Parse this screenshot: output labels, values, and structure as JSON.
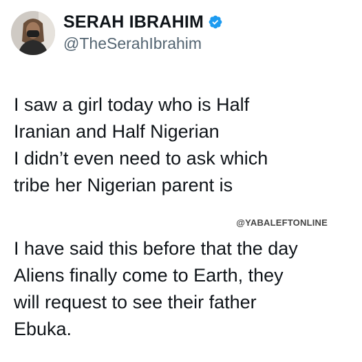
{
  "author": {
    "display_name": "SERAH IBRAHIM",
    "handle": "@TheSerahIbrahim",
    "verified": true
  },
  "tweet": {
    "paragraph_1": "I saw a girl today who is Half\nIranian and Half Nigerian\nI didn’t even need to ask which\ntribe her Nigerian parent is",
    "paragraph_2": "I have said this before that the day\nAliens finally come to Earth, they\nwill request to see their father\nEbuka."
  },
  "watermark": "@YABALEFTONLINE",
  "icons": {
    "verified": "verified-badge-icon",
    "avatar": "profile-photo"
  },
  "colors": {
    "verified_blue": "#1d9bf0",
    "text_primary": "#0f1419",
    "text_secondary": "#536471"
  }
}
